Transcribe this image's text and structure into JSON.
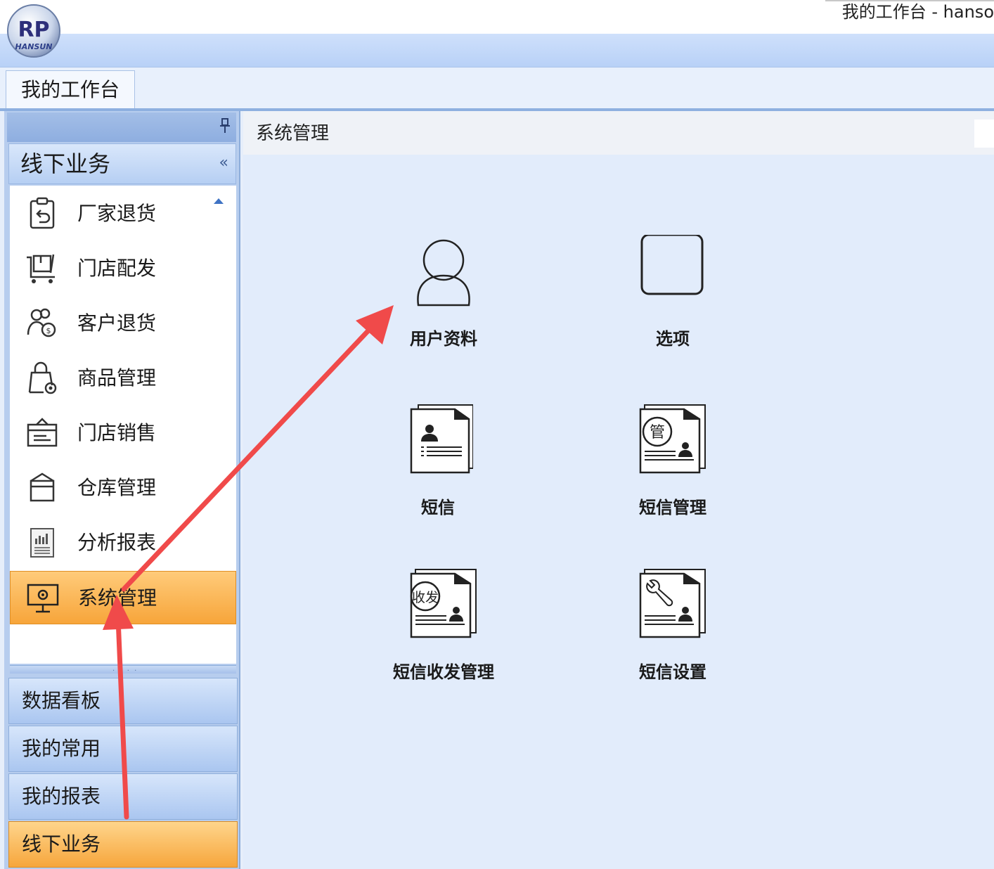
{
  "window": {
    "title": "我的工作台 - hanso"
  },
  "logo": {
    "text": "RP",
    "subtext": "HANSUN"
  },
  "tabs": [
    {
      "label": "我的工作台"
    }
  ],
  "sidebar": {
    "group_header": "线下业务",
    "items": [
      {
        "label": "厂家退货",
        "icon": "return-clipboard-icon"
      },
      {
        "label": "门店配发",
        "icon": "cart-icon"
      },
      {
        "label": "客户退货",
        "icon": "customer-return-icon"
      },
      {
        "label": "商品管理",
        "icon": "product-bag-icon"
      },
      {
        "label": "门店销售",
        "icon": "store-sales-icon"
      },
      {
        "label": "仓库管理",
        "icon": "warehouse-icon"
      },
      {
        "label": "分析报表",
        "icon": "report-icon"
      },
      {
        "label": "系统管理",
        "icon": "monitor-gear-icon",
        "selected": true
      }
    ],
    "nav_buttons": [
      {
        "label": "数据看板"
      },
      {
        "label": "我的常用"
      },
      {
        "label": "我的报表"
      },
      {
        "label": "线下业务",
        "selected": true
      }
    ]
  },
  "content": {
    "title": "系统管理",
    "tiles": [
      {
        "label": "用户资料",
        "icon": "user-outline-icon"
      },
      {
        "label": "选项",
        "icon": "rounded-square-icon"
      },
      {
        "label": "短信",
        "icon": "sms-document-icon"
      },
      {
        "label": "短信管理",
        "icon": "sms-manage-document-icon",
        "badge": "管"
      },
      {
        "label": "短信收发管理",
        "icon": "sms-send-receive-document-icon",
        "badge": "收发"
      },
      {
        "label": "短信设置",
        "icon": "sms-settings-document-icon"
      }
    ]
  },
  "colors": {
    "accent": "#f7a53a",
    "ribbon": "#b8d1f7",
    "annotation_arrow": "#f04a4a"
  }
}
